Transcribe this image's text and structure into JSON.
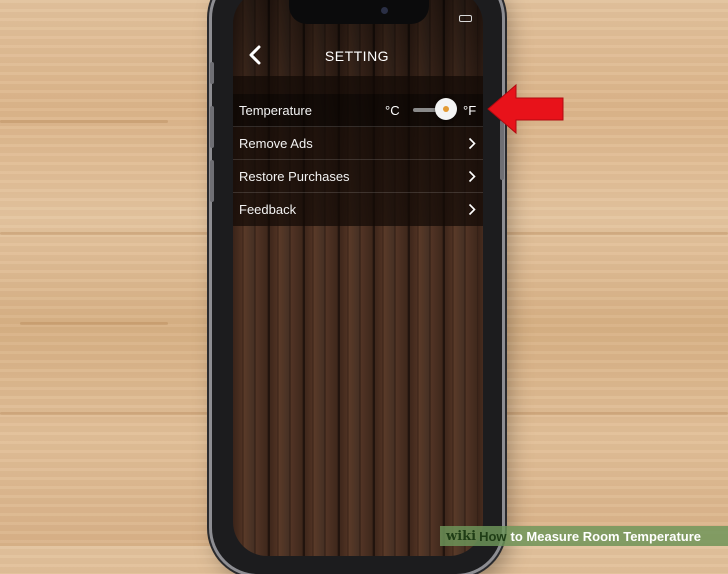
{
  "header": {
    "title": "SETTING",
    "back_icon": "chevron-left-icon"
  },
  "settings": [
    {
      "label": "Temperature",
      "type": "toggle",
      "left_unit": "°C",
      "right_unit": "°F"
    },
    {
      "label": "Remove Ads",
      "type": "link"
    },
    {
      "label": "Restore Purchases",
      "type": "link"
    },
    {
      "label": "Feedback",
      "type": "link"
    }
  ],
  "watermark": {
    "wiki": "wiki",
    "how": "How",
    "rest": "to Measure Room Temperature"
  },
  "colors": {
    "arrow": "#e8121a",
    "knob_dot": "#e39a34"
  }
}
